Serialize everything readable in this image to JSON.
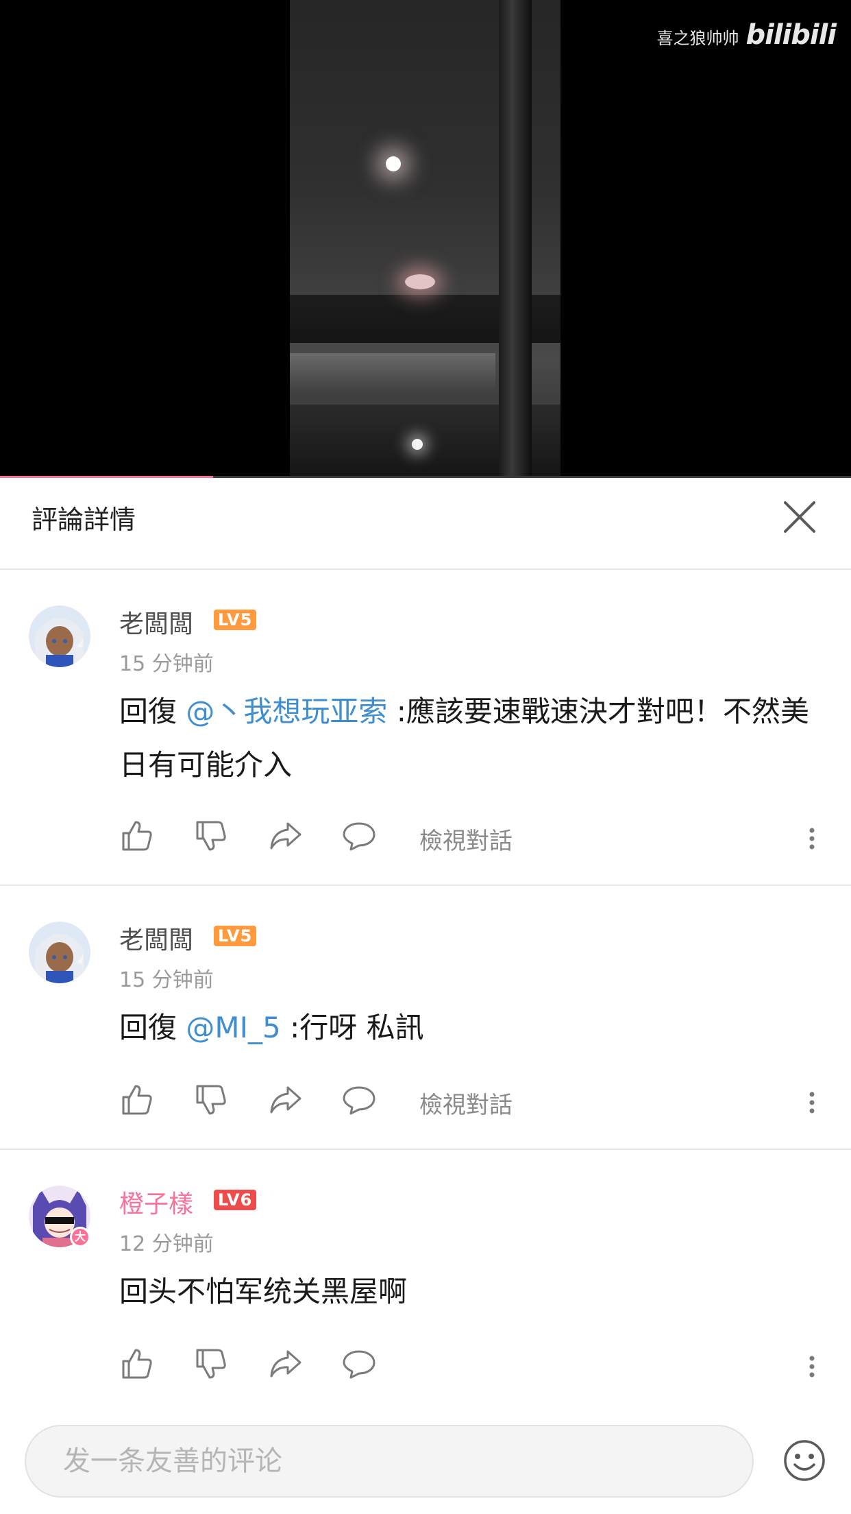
{
  "video": {
    "watermark_user": "喜之狼帅帅",
    "watermark_logo": "bilibili",
    "progress": 0.25
  },
  "header": {
    "title": "評論詳情",
    "close_icon": "close-icon"
  },
  "comments": [
    {
      "username": "老闆闆",
      "level": "LV5",
      "time": "15 分钟前",
      "reply_prefix": "回復",
      "mention": "@丶我想玩亚索",
      "body": ":應該要速戰速決才對吧！不然美日有可能介入",
      "view_conversation": "檢視對話"
    },
    {
      "username": "老闆闆",
      "level": "LV5",
      "time": "15 分钟前",
      "reply_prefix": "回復",
      "mention": "@MI_5",
      "body": ":行呀 私訊",
      "view_conversation": "檢視對話"
    },
    {
      "username": "橙子樣",
      "level": "LV6",
      "time": "12 分钟前",
      "body": "回头不怕军统关黑屋啊",
      "badge": "大"
    }
  ],
  "input": {
    "placeholder": "发一条友善的评论"
  },
  "colors": {
    "accent_pink": "#fb7299",
    "mention_blue": "#3f8ed0",
    "lv5": "#ff9a3e",
    "lv6": "#ee4b4b"
  }
}
